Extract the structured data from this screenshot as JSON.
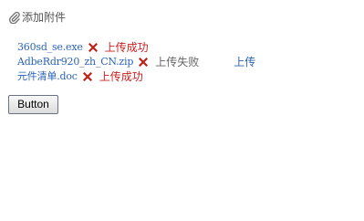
{
  "add_attachment": {
    "label": "添加附件",
    "icon": "paperclip-icon"
  },
  "files": [
    {
      "name": "360sd_se.exe",
      "status": "上传成功",
      "status_type": "success",
      "action": ""
    },
    {
      "name": "AdbeRdr920_zh_CN.zip",
      "status": "上传失败",
      "status_type": "fail",
      "action": "上传"
    },
    {
      "name": "元件清单.doc",
      "status": "上传成功",
      "status_type": "success",
      "action": ""
    }
  ],
  "button": {
    "label": "Button"
  },
  "colors": {
    "link": "#2a63b6",
    "success": "#cc2020",
    "fail": "#666666",
    "delete": "#c0201a"
  }
}
